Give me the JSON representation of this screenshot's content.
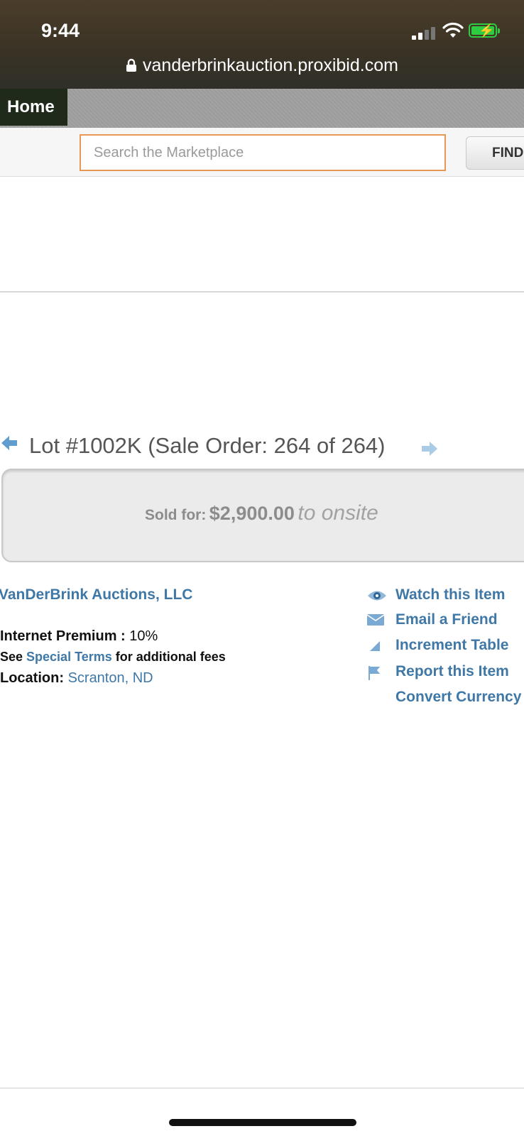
{
  "status_bar": {
    "time": "9:44",
    "url": "vanderbrinkauction.proxibid.com"
  },
  "nav": {
    "home_tab": "Home"
  },
  "search": {
    "placeholder": "Search the Marketplace",
    "button_label": "FIND"
  },
  "lot": {
    "title": "Lot #1002K  (Sale Order: 264 of 264)",
    "sold_label": "Sold for:",
    "sold_amount": "$2,900.00",
    "sold_to": "to onsite"
  },
  "info": {
    "seller": "VanDerBrink Auctions, LLC",
    "premium_label": "Internet Premium",
    "premium_sep": " : ",
    "premium_value": "10%",
    "terms_prefix": "See ",
    "terms_link": "Special Terms",
    "terms_suffix": " for additional fees",
    "location_label": "Location:",
    "location_value": "Scranton, ND"
  },
  "actions": [
    {
      "label": "Watch this Item",
      "icon": "eye-icon"
    },
    {
      "label": "Email a Friend",
      "icon": "envelope-icon"
    },
    {
      "label": "Increment Table",
      "icon": "bar-chart-icon"
    },
    {
      "label": "Report this Item",
      "icon": "flag-icon"
    },
    {
      "label": "Convert Currency",
      "icon": ""
    }
  ],
  "colors": {
    "link": "#3f78a6",
    "search_border": "#e79852",
    "battery": "#2ecc40"
  }
}
